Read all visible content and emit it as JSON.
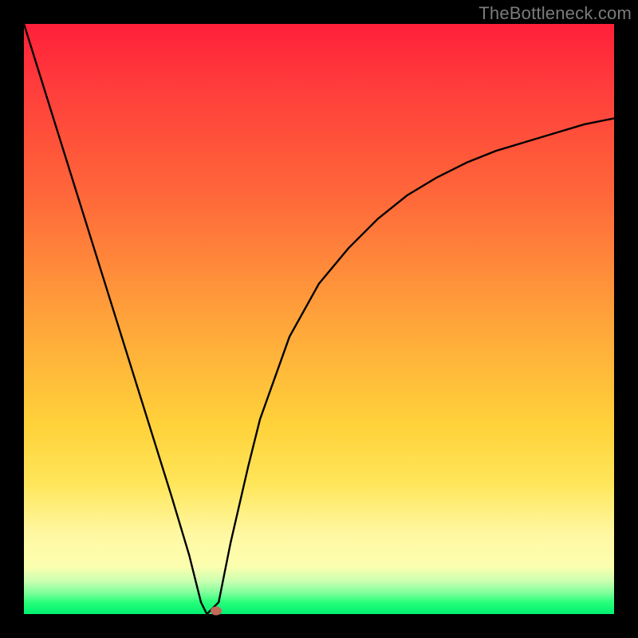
{
  "watermark": "TheBottleneck.com",
  "colors": {
    "frame": "#000000",
    "curve": "#000000",
    "dot": "#c06a5a",
    "gradient_top": "#ff1f3a",
    "gradient_bottom": "#00f070"
  },
  "chart_data": {
    "type": "line",
    "title": "",
    "xlabel": "",
    "ylabel": "",
    "xlim": [
      0,
      100
    ],
    "ylim": [
      0,
      100
    ],
    "grid": false,
    "legend": false,
    "description": "Bottleneck-style V curve: value drops steeply from top-left to a minimum near x≈31 then rises with diminishing slope toward upper-right.",
    "min_point": {
      "x": 31,
      "y": 0
    },
    "series": [
      {
        "name": "curve",
        "x": [
          0,
          5,
          10,
          15,
          20,
          25,
          28,
          30,
          31,
          33,
          35,
          38,
          40,
          45,
          50,
          55,
          60,
          65,
          70,
          75,
          80,
          85,
          90,
          95,
          100
        ],
        "y": [
          100,
          84,
          68,
          52,
          36,
          20,
          10,
          2,
          0,
          2,
          12,
          25,
          33,
          47,
          56,
          62,
          67,
          71,
          74,
          76.5,
          78.5,
          80,
          81.5,
          83,
          84
        ]
      }
    ],
    "marker": {
      "x": 32.5,
      "y": 0.5
    }
  }
}
